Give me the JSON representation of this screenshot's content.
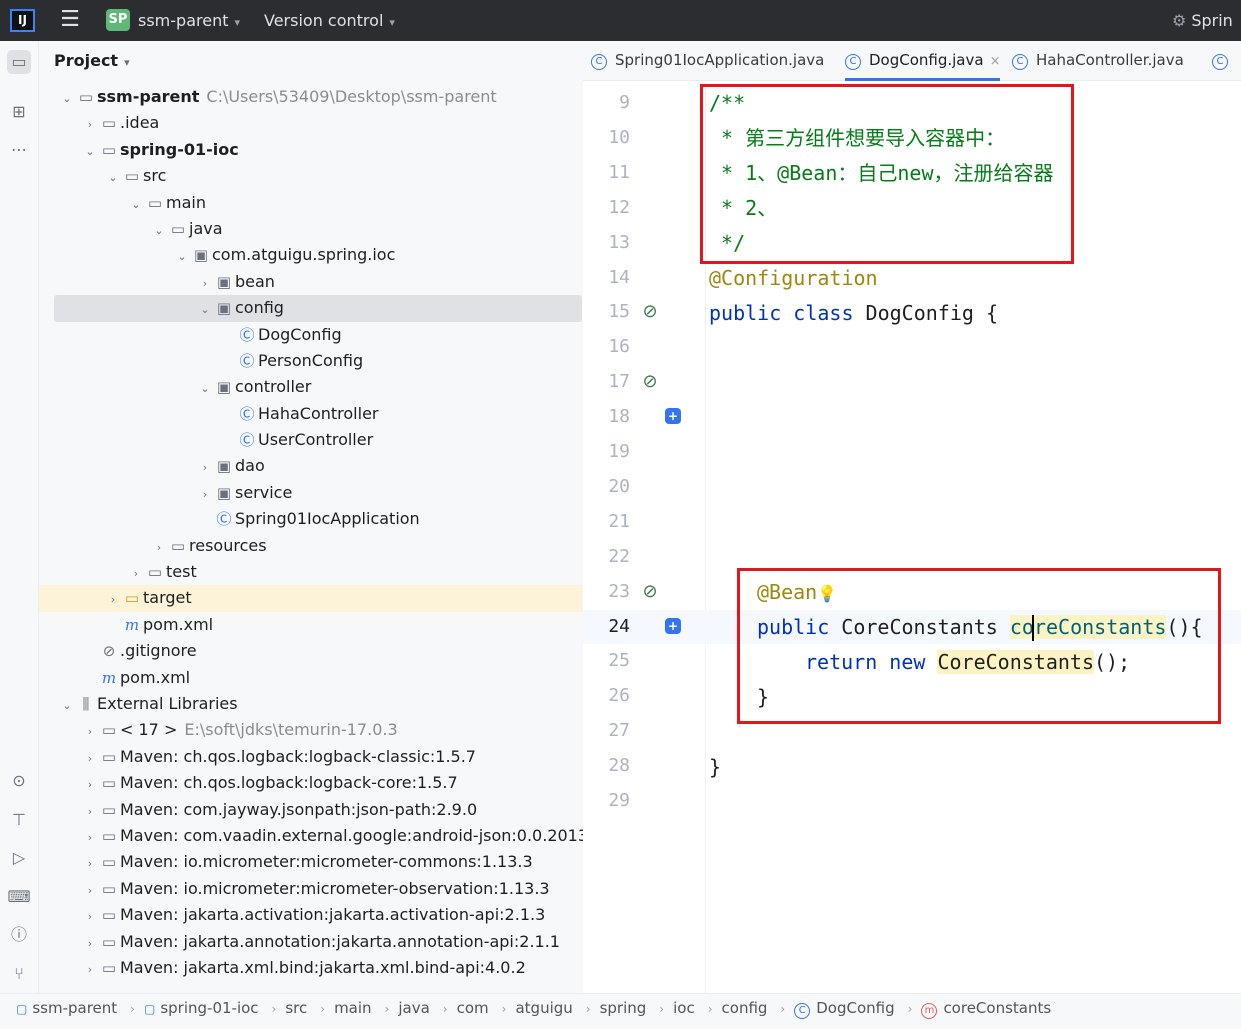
{
  "titlebar": {
    "logo": "IJ",
    "project_badge": "SP",
    "project_name": "ssm-parent",
    "vcs_label": "Version control",
    "run_config": "Sprin"
  },
  "project_panel": {
    "title": "Project",
    "tree": [
      {
        "label": "ssm-parent",
        "path": "C:\\Users\\53409\\Desktop\\ssm-parent",
        "icon": "module-folder-icon",
        "expanded": true
      },
      {
        "label": ".idea",
        "icon": "folder-icon",
        "expanded": false
      },
      {
        "label": "spring-01-ioc",
        "icon": "module-folder-icon",
        "expanded": true
      },
      {
        "label": "src",
        "icon": "folder-icon",
        "expanded": true
      },
      {
        "label": "main",
        "icon": "folder-icon",
        "expanded": true
      },
      {
        "label": "java",
        "icon": "source-folder-icon",
        "expanded": true
      },
      {
        "label": "com.atguigu.spring.ioc",
        "icon": "package-icon",
        "expanded": true
      },
      {
        "label": "bean",
        "icon": "package-icon",
        "expanded": false
      },
      {
        "label": "config",
        "icon": "package-icon",
        "expanded": true,
        "selected": true
      },
      {
        "label": "DogConfig",
        "icon": "class-icon"
      },
      {
        "label": "PersonConfig",
        "icon": "class-icon"
      },
      {
        "label": "controller",
        "icon": "package-icon",
        "expanded": true
      },
      {
        "label": "HahaController",
        "icon": "class-icon"
      },
      {
        "label": "UserController",
        "icon": "class-icon"
      },
      {
        "label": "dao",
        "icon": "package-icon",
        "expanded": false
      },
      {
        "label": "service",
        "icon": "package-icon",
        "expanded": false
      },
      {
        "label": "Spring01IocApplication",
        "icon": "spring-boot-class-icon"
      },
      {
        "label": "resources",
        "icon": "resources-folder-icon",
        "expanded": false
      },
      {
        "label": "test",
        "icon": "folder-icon",
        "expanded": false
      },
      {
        "label": "target",
        "icon": "target-folder-icon",
        "expanded": false,
        "highlighted": true
      },
      {
        "label": "pom.xml",
        "icon": "maven-icon"
      },
      {
        "label": ".gitignore",
        "icon": "ignore-file-icon"
      },
      {
        "label": "pom.xml",
        "icon": "maven-icon"
      },
      {
        "label": "External Libraries",
        "icon": "library-icon",
        "expanded": true
      },
      {
        "label": "< 17 >",
        "path": "E:\\soft\\jdks\\temurin-17.0.3",
        "icon": "jdk-icon",
        "expanded": false
      },
      {
        "label": "Maven: ch.qos.logback:logback-classic:1.5.7",
        "icon": "library-jar-icon",
        "expanded": false
      },
      {
        "label": "Maven: ch.qos.logback:logback-core:1.5.7",
        "icon": "library-jar-icon",
        "expanded": false
      },
      {
        "label": "Maven: com.jayway.jsonpath:json-path:2.9.0",
        "icon": "library-jar-icon",
        "expanded": false
      },
      {
        "label": "Maven: com.vaadin.external.google:android-json:0.0.2013",
        "icon": "library-jar-icon",
        "expanded": false
      },
      {
        "label": "Maven: io.micrometer:micrometer-commons:1.13.3",
        "icon": "library-jar-icon",
        "expanded": false
      },
      {
        "label": "Maven: io.micrometer:micrometer-observation:1.13.3",
        "icon": "library-jar-icon",
        "expanded": false
      },
      {
        "label": "Maven: jakarta.activation:jakarta.activation-api:2.1.3",
        "icon": "library-jar-icon",
        "expanded": false
      },
      {
        "label": "Maven: jakarta.annotation:jakarta.annotation-api:2.1.1",
        "icon": "library-jar-icon",
        "expanded": false
      },
      {
        "label": "Maven: jakarta.xml.bind:jakarta.xml.bind-api:4.0.2",
        "icon": "library-jar-icon",
        "expanded": false
      }
    ]
  },
  "tabs": [
    {
      "label": "Spring01IocApplication.java",
      "active": false
    },
    {
      "label": "DogConfig.java",
      "active": true
    },
    {
      "label": "HahaController.java",
      "active": false
    }
  ],
  "editor": {
    "lines": [
      {
        "num": "9"
      },
      {
        "num": "10"
      },
      {
        "num": "11"
      },
      {
        "num": "12"
      },
      {
        "num": "13"
      },
      {
        "num": "14"
      },
      {
        "num": "15"
      },
      {
        "num": "16"
      },
      {
        "num": "17"
      },
      {
        "num": "18"
      },
      {
        "num": "19"
      },
      {
        "num": "20"
      },
      {
        "num": "21"
      },
      {
        "num": "22"
      },
      {
        "num": "23"
      },
      {
        "num": "24"
      },
      {
        "num": "25"
      },
      {
        "num": "26"
      },
      {
        "num": "27"
      },
      {
        "num": "28"
      },
      {
        "num": "29"
      }
    ],
    "code": {
      "l9": "/**",
      "l10": " * 第三方组件想要导入容器中：",
      "l11": " * 1、@Bean：自己new，注册给容器",
      "l12": " * 2、",
      "l13": " */",
      "l14": "@Configuration",
      "l15_kw1": "public",
      "l15_kw2": "class",
      "l15_rest": " DogConfig {",
      "l23": "@Bean",
      "l24_kw": "public",
      "l24_type": " CoreConstants ",
      "l24_fn_a": "co",
      "l24_fn_b": "reConstants",
      "l24_rest": "(){",
      "l25_kw1": "return",
      "l25_kw2": "new",
      "l25_type": "CoreConstants",
      "l25_rest": "();",
      "l26": "}",
      "l28": "}"
    }
  },
  "breadcrumb": [
    {
      "label": "ssm-parent",
      "icon": "module-icon"
    },
    {
      "label": "spring-01-ioc",
      "icon": "module-icon"
    },
    {
      "label": "src"
    },
    {
      "label": "main"
    },
    {
      "label": "java"
    },
    {
      "label": "com"
    },
    {
      "label": "atguigu"
    },
    {
      "label": "spring"
    },
    {
      "label": "ioc"
    },
    {
      "label": "config"
    },
    {
      "label": "DogConfig",
      "icon": "class-icon"
    },
    {
      "label": "coreConstants",
      "icon": "method-icon"
    }
  ],
  "colors": {
    "accent": "#3574f0",
    "annotation_box": "#e3161b",
    "comment": "#067d17",
    "keyword": "#0033b3",
    "annotation": "#9e880d"
  }
}
